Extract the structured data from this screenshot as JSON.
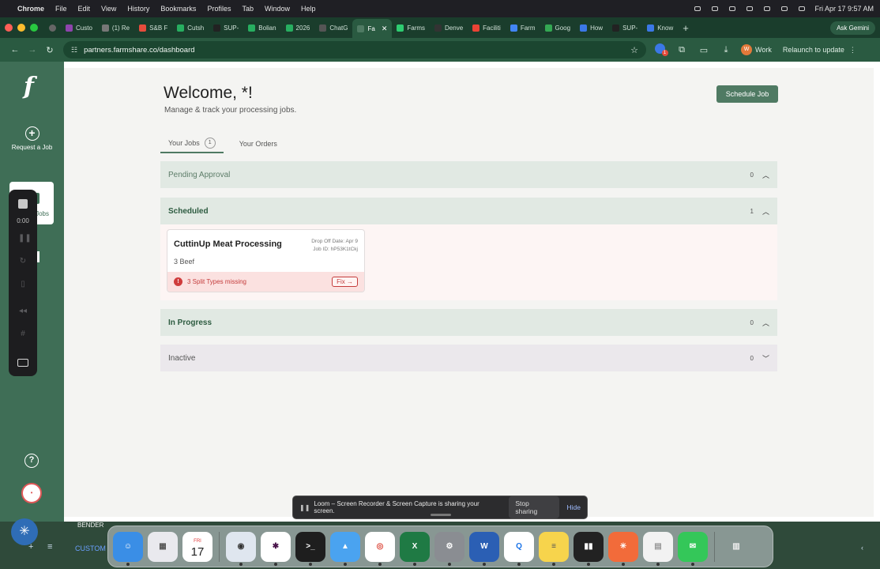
{
  "menubar": {
    "app_name": "Chrome",
    "items": [
      "File",
      "Edit",
      "View",
      "History",
      "Bookmarks",
      "Profiles",
      "Tab",
      "Window",
      "Help"
    ],
    "clock": "Fri Apr 17  9:57 AM"
  },
  "browser": {
    "tabs": [
      {
        "label": "Custo",
        "color": "#8e44ad"
      },
      {
        "label": "(1) Re",
        "color": "#777777"
      },
      {
        "label": "S&B F",
        "color": "#e74c3c"
      },
      {
        "label": "Cutsh",
        "color": "#27ae60"
      },
      {
        "label": "SUP-",
        "color": "#222222"
      },
      {
        "label": "Bolian",
        "color": "#27ae60"
      },
      {
        "label": "2026",
        "color": "#27ae60"
      },
      {
        "label": "ChatG",
        "color": "#555555"
      },
      {
        "label": "Fa",
        "color": "#4f7a63",
        "active": true
      },
      {
        "label": "Farms",
        "color": "#2ecc71"
      },
      {
        "label": "Denve",
        "color": "#333333"
      },
      {
        "label": "Faciliti",
        "color": "#ea4335"
      },
      {
        "label": "Farm",
        "color": "#4285f4"
      },
      {
        "label": "Goog",
        "color": "#34a853"
      },
      {
        "label": "How",
        "color": "#3b78e7"
      },
      {
        "label": "SUP-",
        "color": "#222222"
      },
      {
        "label": "Know",
        "color": "#3b78e7"
      }
    ],
    "ask_gemini": "Ask Gemini",
    "url": "partners.farmshare.co/dashboard",
    "profile_label": "Work",
    "profile_initial": "W",
    "relaunch_label": "Relaunch to update"
  },
  "sidebar": {
    "logo": "f",
    "request_job_label": "Request a Job",
    "jobs_label": "Jobs",
    "user_initial": "•"
  },
  "dashboard": {
    "title": "Welcome, *!",
    "subtitle": "Manage & track your processing jobs.",
    "schedule_button": "Schedule Job",
    "tabs": {
      "jobs_label": "Your Jobs",
      "jobs_count": "1",
      "orders_label": "Your Orders"
    },
    "sections": {
      "pending": {
        "title": "Pending Approval",
        "count": "0"
      },
      "scheduled": {
        "title": "Scheduled",
        "count": "1"
      },
      "in_progress": {
        "title": "In Progress",
        "count": "0"
      },
      "inactive": {
        "title": "Inactive",
        "count": "0"
      }
    },
    "job_card": {
      "name": "CuttinUp Meat Processing",
      "drop_off": "Drop Off Date: Apr 9",
      "job_id": "Job ID: hP53K1tCkj",
      "quantity": "3 Beef",
      "alert": "3 Split Types missing",
      "fix_label": "Fix →"
    }
  },
  "loom": {
    "timer": "0:00",
    "banner_text": "Loom – Screen Recorder & Screen Capture is sharing your screen.",
    "stop_sharing": "Stop sharing",
    "hide": "Hide"
  },
  "underlying": {
    "bench_label": "BENDER",
    "custom_label": "CUSTOM"
  },
  "dock": {
    "calendar_month": "FRI",
    "calendar_day": "17"
  }
}
